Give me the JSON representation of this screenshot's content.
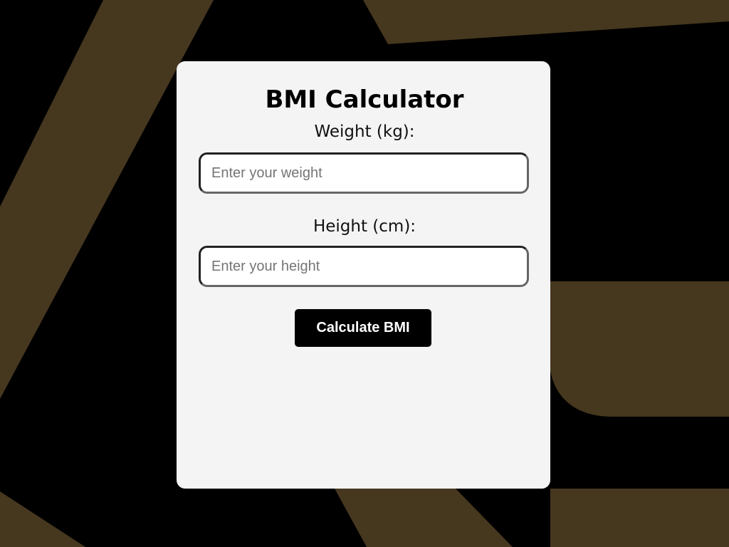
{
  "app": {
    "title": "BMI Calculator"
  },
  "form": {
    "weight_label": "Weight (kg):",
    "weight_placeholder": "Enter your weight",
    "weight_value": "",
    "height_label": "Height (cm):",
    "height_placeholder": "Enter your height",
    "height_value": "",
    "calculate_label": "Calculate BMI"
  },
  "colors": {
    "background": "#000000",
    "background_shape": "#46371f",
    "card": "#f4f4f4",
    "button": "#000000",
    "button_text": "#ffffff"
  }
}
